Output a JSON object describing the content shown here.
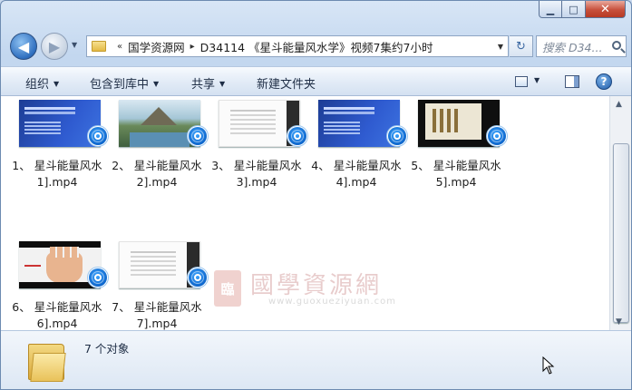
{
  "window": {
    "caption": {
      "minimize": "▁",
      "maximize": "□",
      "close": "✕"
    }
  },
  "nav": {
    "back_glyph": "◀",
    "forward_glyph": "▶",
    "address": {
      "prefix": "«",
      "crumbs": [
        "国学资源网",
        "D34114 《星斗能量风水学》视频7集约7小时"
      ],
      "separator": "▸"
    },
    "refresh_glyph": "↻",
    "search_placeholder": "搜索 D34..."
  },
  "toolbar": {
    "organize": "组织",
    "include_in_library": "包含到库中",
    "share": "共享",
    "new_folder": "新建文件夹",
    "help": "?"
  },
  "files": [
    {
      "line1": "1、 星斗能量风水",
      "line2": "1].mp4",
      "thumb": "blue"
    },
    {
      "line1": "2、 星斗能量风水",
      "line2": "2].mp4",
      "thumb": "land"
    },
    {
      "line1": "3、 星斗能量风水",
      "line2": "3].mp4",
      "thumb": "doc"
    },
    {
      "line1": "4、 星斗能量风水",
      "line2": "4].mp4",
      "thumb": "blue"
    },
    {
      "line1": "5、 星斗能量风水",
      "line2": "5].mp4",
      "thumb": "dark"
    },
    {
      "line1": "6、 星斗能量风水",
      "line2": "6].mp4",
      "thumb": "hand"
    },
    {
      "line1": "7、 星斗能量风水",
      "line2": "7].mp4",
      "thumb": "doc"
    }
  ],
  "watermark": {
    "seal": "臨",
    "title": "國學資源網",
    "url": "www.guoxueziyuan.com"
  },
  "details": {
    "count": "7 个对象"
  }
}
